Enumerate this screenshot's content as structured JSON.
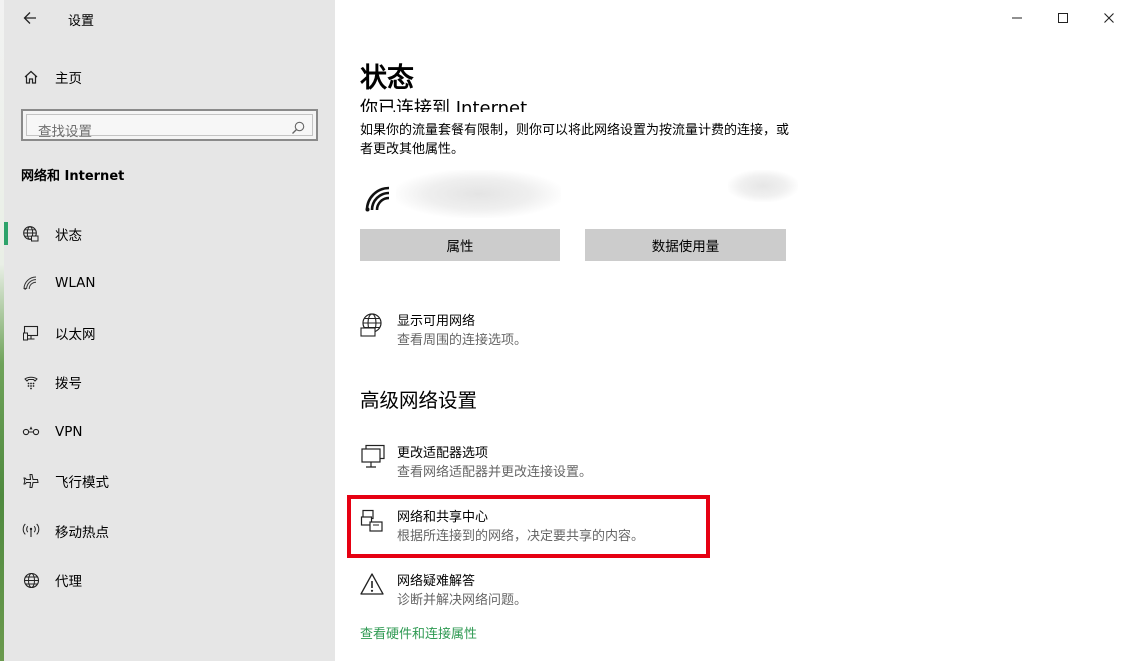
{
  "window": {
    "title": "设置"
  },
  "sidebar": {
    "home_label": "主页",
    "search_placeholder": "查找设置",
    "section_label": "网络和 Internet",
    "items": [
      {
        "label": "状态",
        "icon": "status-globe-icon",
        "active": true
      },
      {
        "label": "WLAN",
        "icon": "wifi-icon"
      },
      {
        "label": "以太网",
        "icon": "ethernet-icon"
      },
      {
        "label": "拨号",
        "icon": "dialup-icon"
      },
      {
        "label": "VPN",
        "icon": "vpn-icon"
      },
      {
        "label": "飞行模式",
        "icon": "airplane-icon"
      },
      {
        "label": "移动热点",
        "icon": "hotspot-icon"
      },
      {
        "label": "代理",
        "icon": "globe-icon"
      }
    ]
  },
  "main": {
    "page_title": "状态",
    "connected_heading": "你已连接到 Internet",
    "description": "如果你的流量套餐有限制，则你可以将此网络设置为按流量计费的连接，或者更改其他属性。",
    "buttons": {
      "properties": "属性",
      "data_usage": "数据使用量"
    },
    "show_networks": {
      "title": "显示可用网络",
      "subtitle": "查看周围的连接选项。"
    },
    "advanced_heading": "高级网络设置",
    "adapter": {
      "title": "更改适配器选项",
      "subtitle": "查看网络适配器并更改连接设置。"
    },
    "sharing_center": {
      "title": "网络和共享中心",
      "subtitle": "根据所连接到的网络，决定要共享的内容。"
    },
    "troubleshoot": {
      "title": "网络疑难解答",
      "subtitle": "诊断并解决网络问题。"
    },
    "hardware_link": "查看硬件和连接属性"
  },
  "colors": {
    "accent": "#2da36a",
    "link": "#2f9a53",
    "highlight": "#e60012",
    "sidebar_bg": "#e6e6e6",
    "button_bg": "#cccccc"
  }
}
